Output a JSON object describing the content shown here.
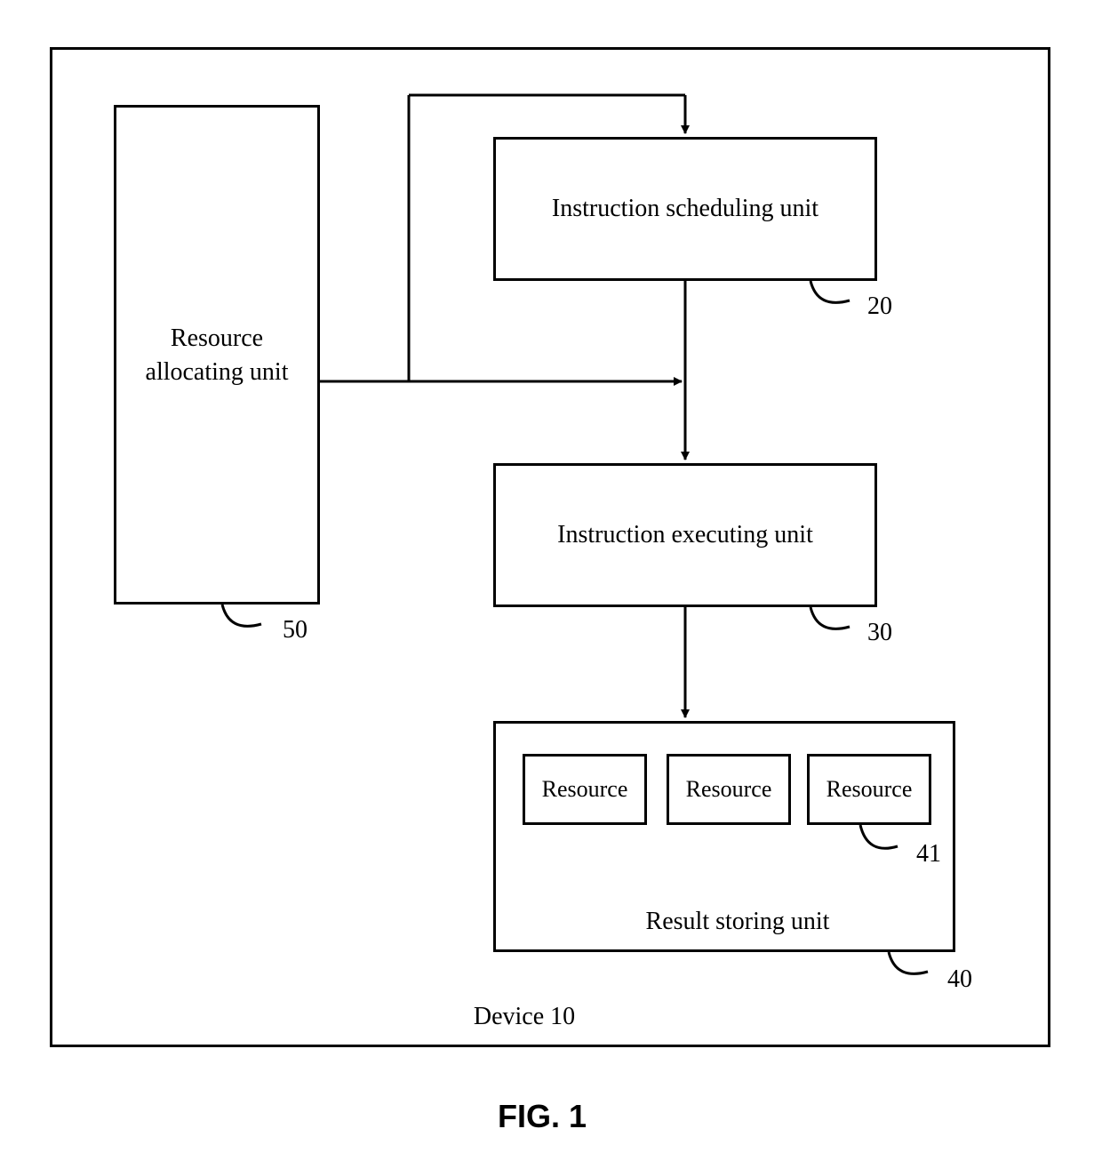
{
  "figure_label": "FIG. 1",
  "device": {
    "label": "Device 10"
  },
  "blocks": {
    "resource_allocating": {
      "label": "Resource\nallocating unit",
      "ref": "50"
    },
    "instruction_scheduling": {
      "label": "Instruction scheduling unit",
      "ref": "20"
    },
    "instruction_executing": {
      "label": "Instruction executing unit",
      "ref": "30"
    },
    "result_storing": {
      "label": "Result storing unit",
      "ref": "40",
      "resources": [
        "Resource",
        "Resource",
        "Resource"
      ],
      "resource_ref": "41"
    }
  }
}
